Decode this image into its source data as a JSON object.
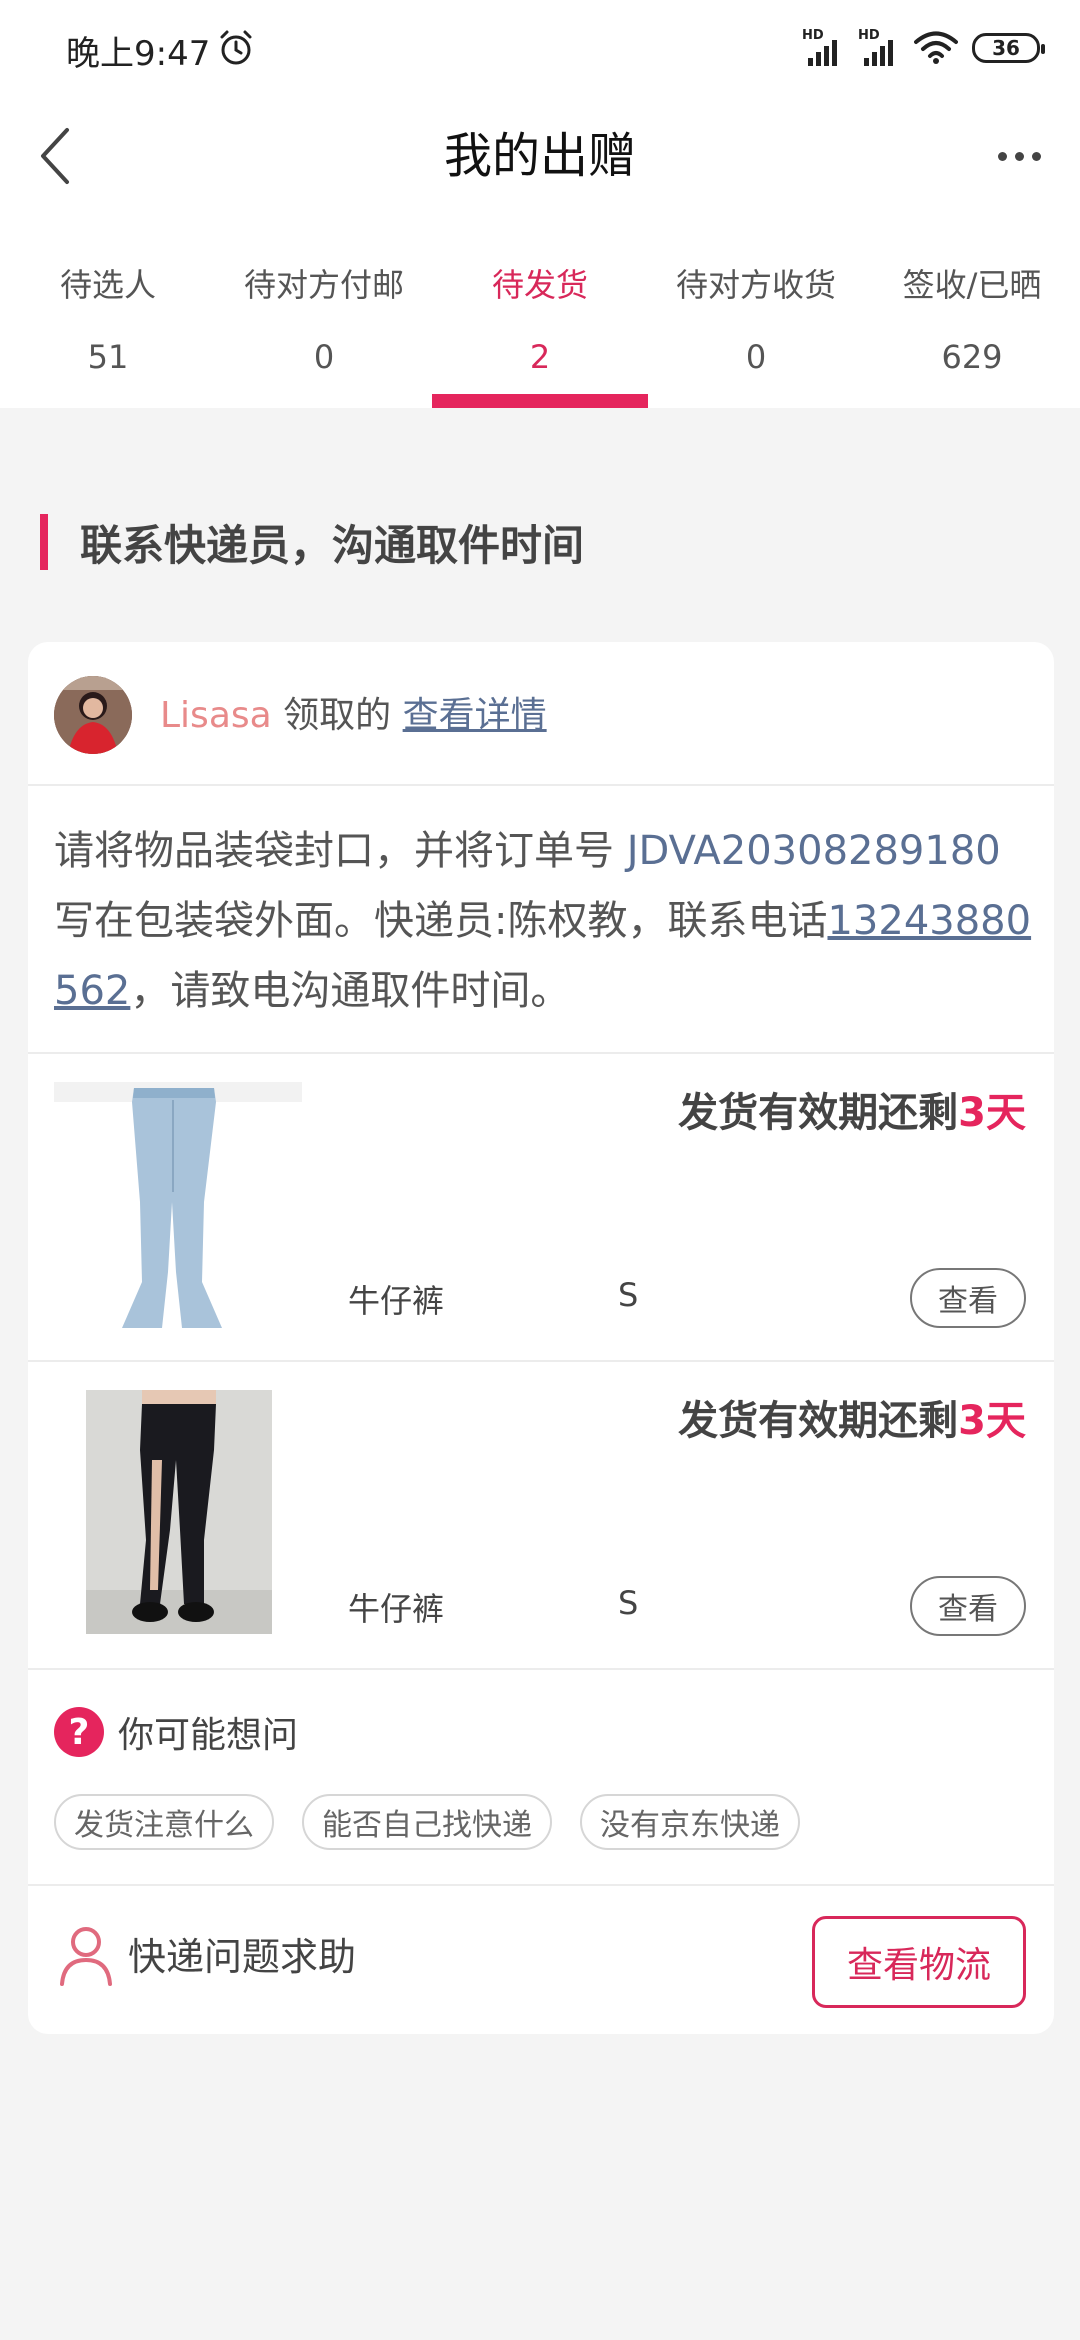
{
  "status_bar": {
    "time": "晚上9:47",
    "alarm_icon": "alarm-clock-icon",
    "hd1": "HD",
    "hd2": "HD",
    "battery": "36"
  },
  "nav": {
    "title": "我的出赠",
    "back_icon": "chevron-left-icon",
    "more_icon": "more-dots-icon"
  },
  "tabs": [
    {
      "label": "待选人",
      "count": "51"
    },
    {
      "label": "待对方付邮",
      "count": "0"
    },
    {
      "label": "待发货",
      "count": "2"
    },
    {
      "label": "待对方收货",
      "count": "0"
    },
    {
      "label": "签收/已晒",
      "count": "629"
    }
  ],
  "active_tab_color": "#e5255d",
  "section": {
    "title": "联系快递员，沟通取件时间"
  },
  "card": {
    "claim": {
      "user": "Lisasa",
      "mid": "领取的",
      "link": "查看详情"
    },
    "instruction": {
      "part1": "请将物品装袋封口，并将订单号 ",
      "order_no": "JDVA20308289180",
      "part2": " 写在包装袋外面。快递员:陈权教，联系电话",
      "phone": "13243880562",
      "part3": "，请致电沟通取件时间。"
    },
    "items": [
      {
        "deadline_prefix": "发货有效期还剩",
        "deadline_days": "3天",
        "name": "牛仔裤",
        "size": "S",
        "view": "查看"
      },
      {
        "deadline_prefix": "发货有效期还剩",
        "deadline_days": "3天",
        "name": "牛仔裤",
        "size": "S",
        "view": "查看"
      }
    ],
    "faq": {
      "icon": "question-mark-icon",
      "icon_text": "?",
      "title": "你可能想问",
      "chips": [
        "发货注意什么",
        "能否自己找快递",
        "没有京东快递"
      ]
    },
    "help": {
      "icon": "person-icon",
      "label": "快递问题求助",
      "button": "查看物流"
    }
  }
}
